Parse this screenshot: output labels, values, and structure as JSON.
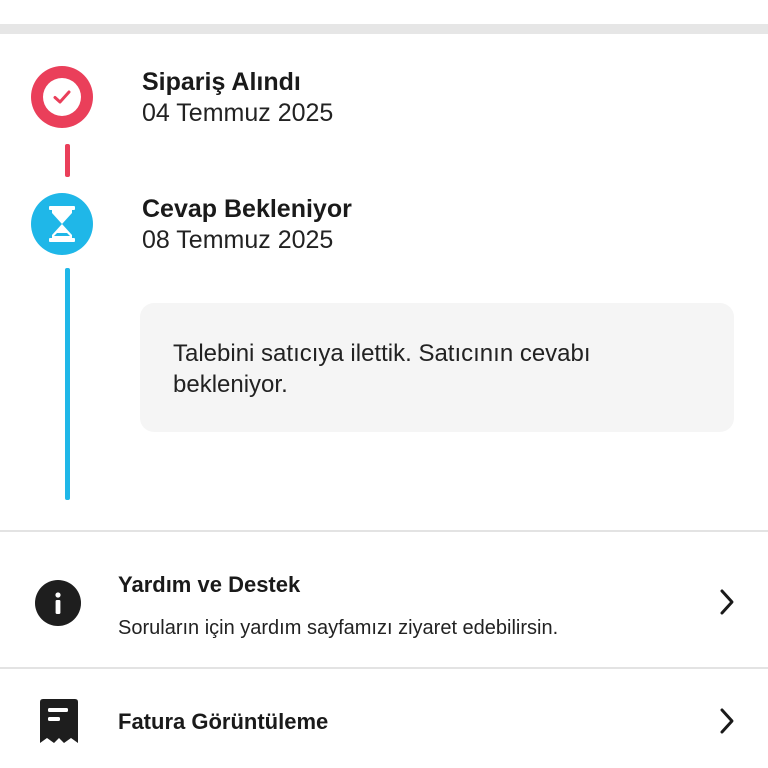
{
  "timeline": {
    "steps": [
      {
        "title": "Sipariş Alındı",
        "date": "04 Temmuz 2025",
        "status": "completed",
        "icon": "check-circle-icon",
        "color": "#ea3f5a"
      },
      {
        "title": "Cevap Bekleniyor",
        "date": "08 Temmuz 2025",
        "status": "waiting",
        "icon": "hourglass-icon",
        "color": "#1fb7e8"
      }
    ],
    "message": "Talebini satıcıya ilettik. Satıcının cevabı bekleniyor."
  },
  "links": {
    "help": {
      "title": "Yardım ve Destek",
      "subtitle": "Soruların için yardım sayfamızı ziyaret edebilirsin.",
      "icon": "info-icon"
    },
    "invoice": {
      "title": "Fatura Görüntüleme",
      "icon": "receipt-icon"
    }
  }
}
